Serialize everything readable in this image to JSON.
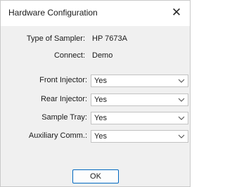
{
  "window": {
    "title": "Hardware Configuration",
    "close_glyph": "✕"
  },
  "info": {
    "sampler_label": "Type of Sampler:",
    "sampler_value": "HP 7673A",
    "connect_label": "Connect:",
    "connect_value": "Demo"
  },
  "fields": [
    {
      "label": "Front Injector:",
      "value": "Yes"
    },
    {
      "label": "Rear Injector:",
      "value": "Yes"
    },
    {
      "label": "Sample Tray:",
      "value": "Yes"
    },
    {
      "label": "Auxiliary Comm.:",
      "value": "Yes"
    }
  ],
  "buttons": {
    "ok_label": "OK"
  },
  "colors": {
    "accent": "#0067c0",
    "dialog_bg": "#f0f0f0",
    "titlebar_bg": "#ffffff"
  },
  "icons": {
    "close": "close-icon",
    "dropdown": "chevron-down-icon"
  }
}
